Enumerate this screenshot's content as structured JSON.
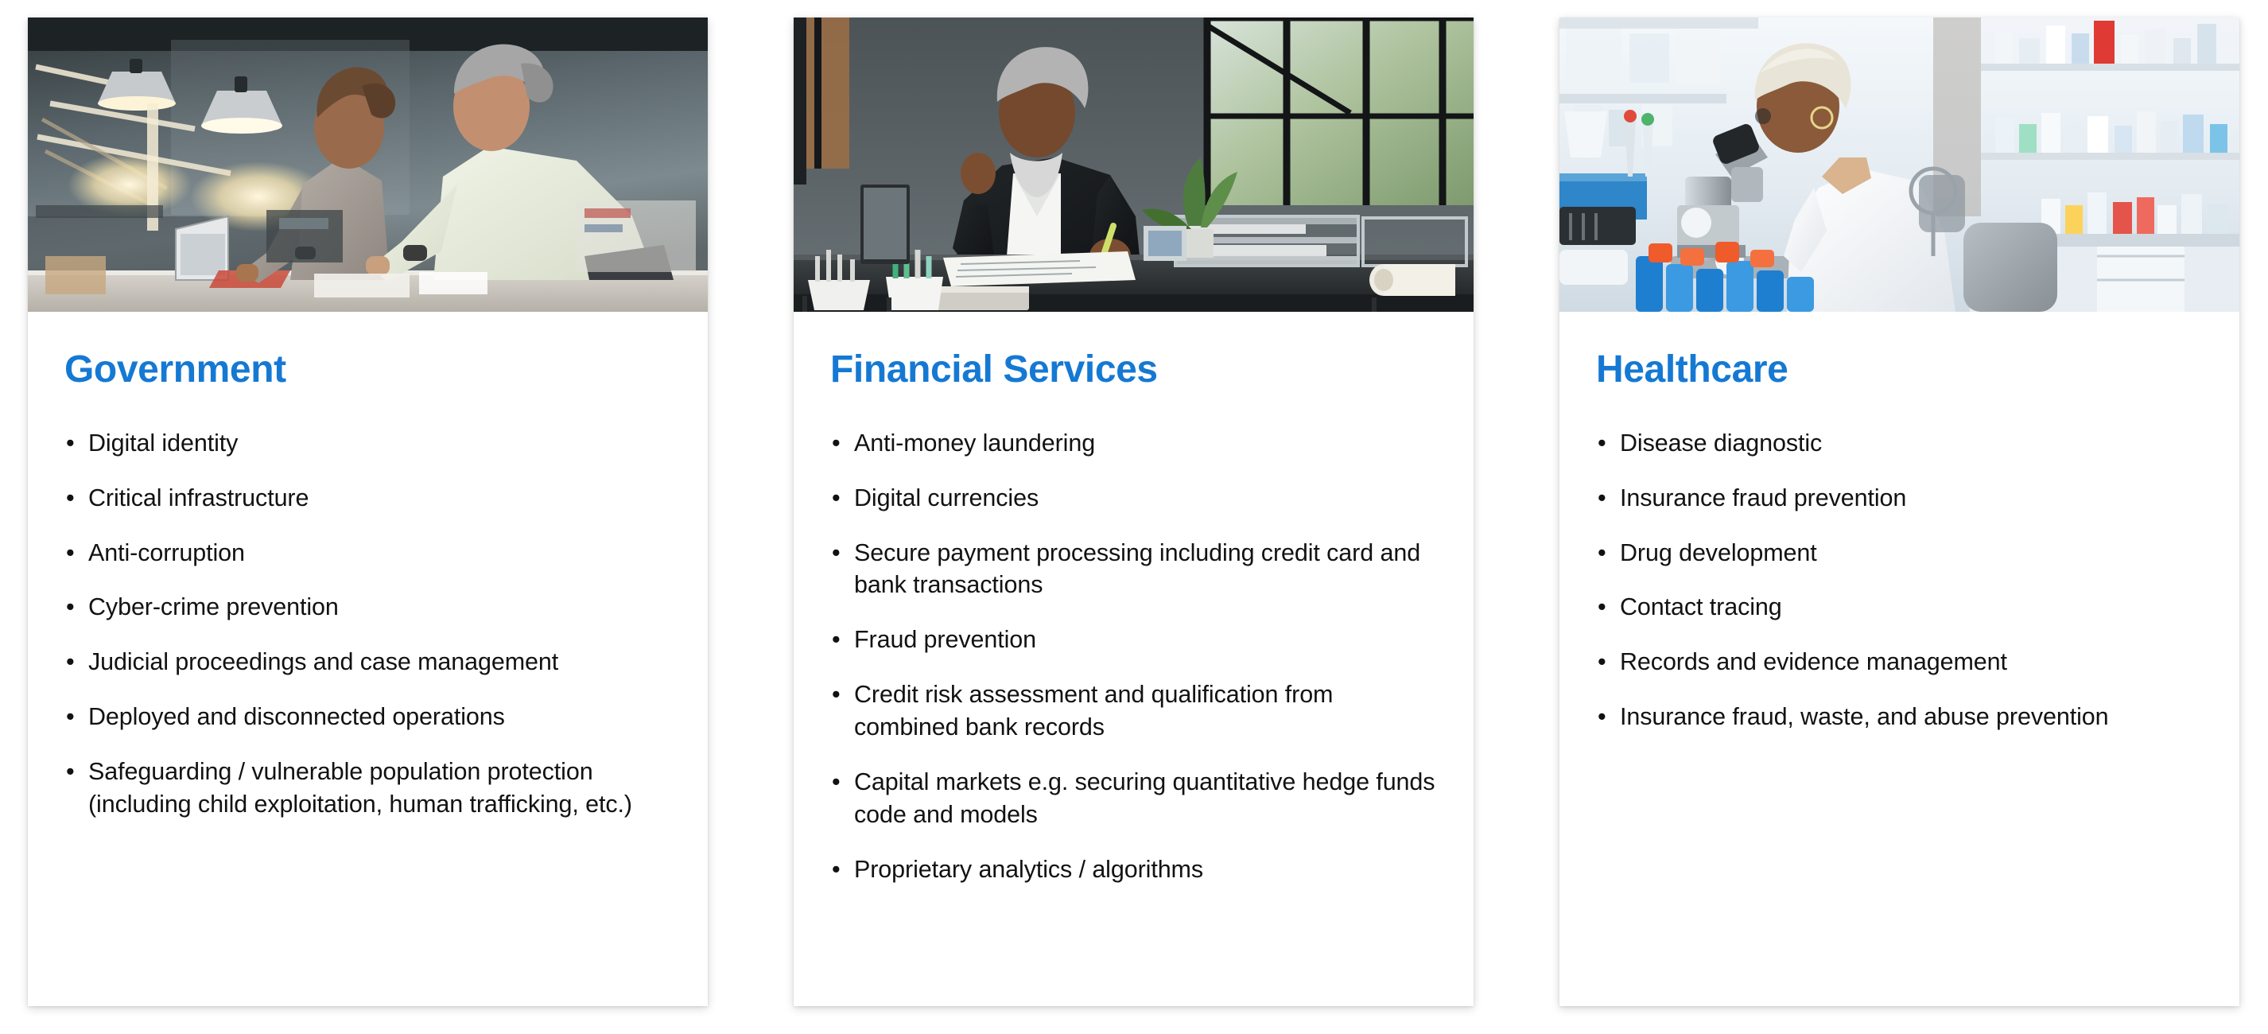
{
  "theme": {
    "title_color": "#1579D3",
    "text_color": "#121212",
    "card_background": "#ffffff",
    "page_background": "#ffffff"
  },
  "cards": [
    {
      "image_name": "two-office-workers-collaborating-at-laptop",
      "title": "Government",
      "bullets": [
        "Digital identity",
        "Critical infrastructure",
        "Anti-corruption",
        "Cyber-crime prevention",
        "Judicial proceedings and case management",
        "Deployed and disconnected operations",
        "Safeguarding / vulnerable population protection (including child exploitation, human trafficking, etc.)"
      ]
    },
    {
      "image_name": "businessman-reviewing-documents-at-desk",
      "title": "Financial Services",
      "bullets": [
        "Anti-money laundering",
        "Digital currencies",
        "Secure payment processing including credit card and bank transactions",
        "Fraud prevention",
        "Credit risk assessment and qualification from combined bank records",
        "Capital markets e.g. securing quantitative hedge funds code and models",
        "Proprietary analytics / algorithms"
      ]
    },
    {
      "image_name": "scientist-using-microscope-in-laboratory",
      "title": "Healthcare",
      "bullets": [
        "Disease diagnostic",
        "Insurance fraud prevention",
        "Drug development",
        "Contact tracing",
        "Records and evidence management",
        "Insurance fraud, waste, and abuse prevention"
      ]
    }
  ]
}
